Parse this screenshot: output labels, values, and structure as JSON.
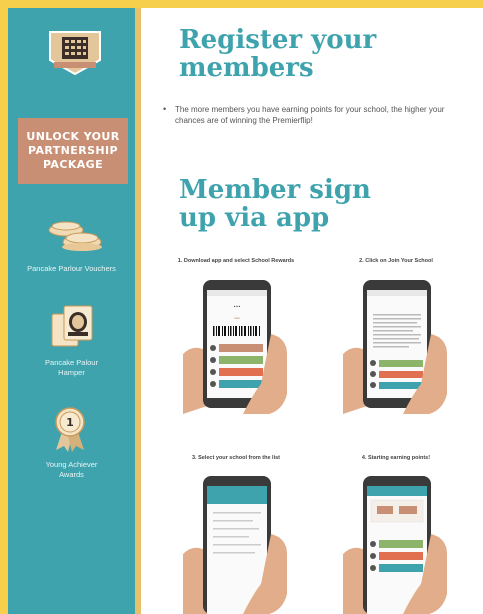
{
  "sidebar": {
    "banner_text": "UNLOCK YOUR PARTNERSHIP PACKAGE",
    "perks": [
      {
        "label": "Pancake Parlour Vouchers",
        "icon": "pancakes-icon"
      },
      {
        "label": "Pancake Palour Hamper",
        "icon": "hamper-icon"
      },
      {
        "label": "Young Achiever Awards",
        "icon": "award-ribbon-icon"
      }
    ]
  },
  "main": {
    "heading_register": "Register your members",
    "bullet": "The more members you have earning points for your school, the higher your chances are of winning the Premierflip!",
    "heading_signup": "Member sign up via app",
    "steps": [
      {
        "title": "1. Download app and select School Rewards"
      },
      {
        "title": "2. Click on Join Your School"
      },
      {
        "title": "3. Select your school from the list"
      },
      {
        "title": "4. Starting earning points!"
      }
    ]
  },
  "colors": {
    "teal": "#3ea3ad",
    "banner": "#c98f74",
    "gold_border": "#f6d04d"
  }
}
